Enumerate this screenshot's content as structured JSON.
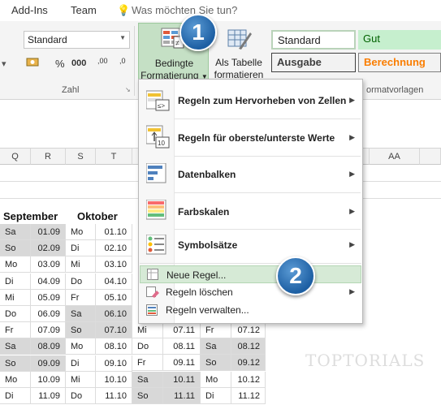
{
  "menubar": {
    "addins": "Add-Ins",
    "team": "Team",
    "tell_me_placeholder": "Was möchten Sie tun?"
  },
  "ribbon": {
    "number_format": "Standard",
    "percent": "%",
    "thousands": "000",
    "dec_increase": ",00",
    "dec_decrease": ",0",
    "group_number": "Zahl",
    "cond_format_line1": "Bedingte",
    "cond_format_line2": "Formatierung",
    "table_line1": "Als Tabelle",
    "table_line2": "formatieren",
    "styles": {
      "standard": "Standard",
      "gut": "Gut",
      "ausgabe": "Ausgabe",
      "berechnung": "Berechnung"
    },
    "group_styles": "ormatvorlagen"
  },
  "columns": [
    "Q",
    "R",
    "S",
    "T",
    "AA"
  ],
  "months": {
    "september": "September",
    "oktober": "Oktober"
  },
  "rows": [
    {
      "q": "Sa",
      "r": "01.09",
      "s": "Mo",
      "t": "01.10",
      "greyQR": true,
      "greyST": false
    },
    {
      "q": "So",
      "r": "02.09",
      "s": "Di",
      "t": "02.10",
      "greyQR": true,
      "greyST": false
    },
    {
      "q": "Mo",
      "r": "03.09",
      "s": "Mi",
      "t": "03.10",
      "greyQR": false,
      "greyST": false
    },
    {
      "q": "Di",
      "r": "04.09",
      "s": "Do",
      "t": "04.10",
      "greyQR": false,
      "greyST": false
    },
    {
      "q": "Mi",
      "r": "05.09",
      "s": "Fr",
      "t": "05.10",
      "greyQR": false,
      "greyST": false
    },
    {
      "q": "Do",
      "r": "06.09",
      "s": "Sa",
      "t": "06.10",
      "greyQR": false,
      "greyST": true
    },
    {
      "q": "Fr",
      "r": "07.09",
      "s": "So",
      "t": "07.10",
      "greyQR": false,
      "greyST": true
    },
    {
      "q": "Sa",
      "r": "08.09",
      "s": "Mo",
      "t": "08.10",
      "greyQR": true,
      "greyST": false
    },
    {
      "q": "So",
      "r": "09.09",
      "s": "Di",
      "t": "09.10",
      "greyQR": true,
      "greyST": false
    },
    {
      "q": "Mo",
      "r": "10.09",
      "s": "Mi",
      "t": "10.10",
      "greyQR": false,
      "greyST": false
    },
    {
      "q": "Di",
      "r": "11.09",
      "s": "Do",
      "t": "11.10",
      "greyQR": false,
      "greyST": false
    }
  ],
  "extra_rows": [
    {
      "u": "Mi",
      "v": "07.11",
      "w": "Fr",
      "x": "07.12",
      "greyUV": false,
      "greyWX": false
    },
    {
      "u": "Do",
      "v": "08.11",
      "w": "Sa",
      "x": "08.12",
      "greyUV": false,
      "greyWX": true
    },
    {
      "u": "Fr",
      "v": "09.11",
      "w": "So",
      "x": "09.12",
      "greyUV": false,
      "greyWX": true
    },
    {
      "u": "Sa",
      "v": "10.11",
      "w": "Mo",
      "x": "10.12",
      "greyUV": true,
      "greyWX": false
    },
    {
      "u": "So",
      "v": "11.11",
      "w": "Di",
      "x": "11.12",
      "greyUV": true,
      "greyWX": false
    }
  ],
  "menu": {
    "item1": "Regeln zum Hervorheben von Zellen",
    "item2": "Regeln für oberste/unterste Werte",
    "item3": "Datenbalken",
    "item4": "Farbskalen",
    "item5": "Symbolsätze",
    "item6": "Neue Regel...",
    "item7": "Regeln löschen",
    "item8": "Regeln verwalten..."
  },
  "badges": {
    "one": "1",
    "two": "2"
  },
  "watermark": "TOPTORIALS",
  "colors": {
    "highlight": "#d6ead6",
    "badge": "#2e75b6",
    "gut_bg": "#c6efce",
    "gut_fg": "#006100",
    "berechnung_fg": "#fa7d00",
    "weekend_grey": "#d8d8d8"
  }
}
